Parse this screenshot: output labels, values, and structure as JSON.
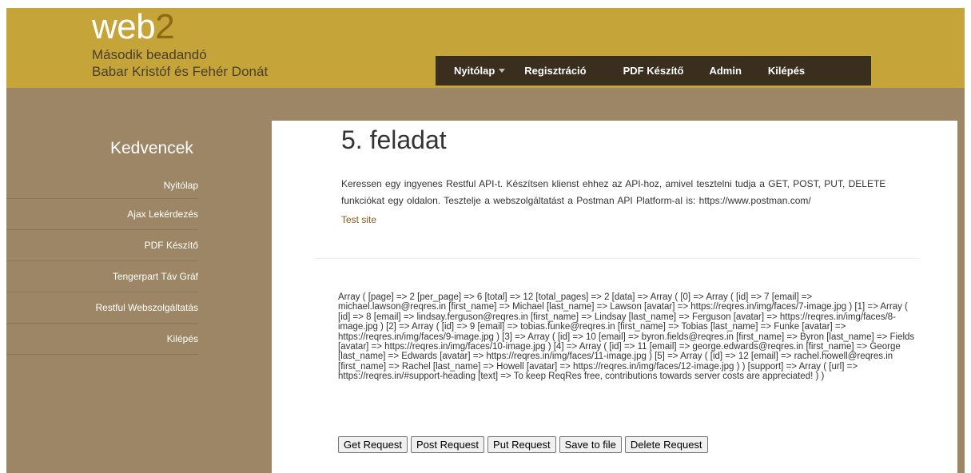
{
  "header": {
    "logo_main": "web",
    "logo_accent": "2",
    "subtitle_line1": "Második beadandó",
    "subtitle_line2": "Babar Kristóf és Fehér Donát"
  },
  "nav": {
    "items": [
      {
        "label": "Nyitólap"
      },
      {
        "label": "Regisztráció"
      },
      {
        "label": "PDF Készítő"
      },
      {
        "label": "Admin"
      },
      {
        "label": "Kilépés"
      }
    ]
  },
  "sidebar": {
    "title": "Kedvencek",
    "items": [
      {
        "label": "Nyitólap"
      },
      {
        "label": "Ajax Lekérdezés"
      },
      {
        "label": "PDF Készítő"
      },
      {
        "label": "Tengerpart Táv Gráf"
      },
      {
        "label": "Restful Webszolgáltatás"
      },
      {
        "label": "Kilépés"
      }
    ]
  },
  "main": {
    "title": "5. feladat",
    "description": "Keressen egy ingyenes Restful API-t. Készítsen klienst ehhez az API-hoz, amivel tesztelni tudja a GET, POST, PUT, DELETE funkciókat egy oldalon. Tesztelje a webszolgáltatást a Postman API Platform-al is: https://www.postman.com/",
    "test_link": "Test site",
    "output": "Array ( [page] => 2 [per_page] => 6 [total] => 12 [total_pages] => 2 [data] => Array ( [0] => Array ( [id] => 7 [email] => michael.lawson@reqres.in [first_name] => Michael [last_name] => Lawson [avatar] => https://reqres.in/img/faces/7-image.jpg ) [1] => Array ( [id] => 8 [email] => lindsay.ferguson@reqres.in [first_name] => Lindsay [last_name] => Ferguson [avatar] => https://reqres.in/img/faces/8-image.jpg ) [2] => Array ( [id] => 9 [email] => tobias.funke@reqres.in [first_name] => Tobias [last_name] => Funke [avatar] => https://reqres.in/img/faces/9-image.jpg ) [3] => Array ( [id] => 10 [email] => byron.fields@reqres.in [first_name] => Byron [last_name] => Fields [avatar] => https://reqres.in/img/faces/10-image.jpg ) [4] => Array ( [id] => 11 [email] => george.edwards@reqres.in [first_name] => George [last_name] => Edwards [avatar] => https://reqres.in/img/faces/11-image.jpg ) [5] => Array ( [id] => 12 [email] => rachel.howell@reqres.in [first_name] => Rachel [last_name] => Howell [avatar] => https://reqres.in/img/faces/12-image.jpg ) ) [support] => Array ( [url] => https://reqres.in/#support-heading [text] => To keep ReqRes free, contributions towards server costs are appreciated! ) )",
    "buttons": {
      "get": "Get Request",
      "post": "Post Request",
      "put": "Put Request",
      "save": "Save to file",
      "delete": "Delete Request"
    }
  },
  "colors": {
    "header_bg": "#c5a43a",
    "body_bg": "#9d8666",
    "nav_bg": "#3a2f1e",
    "link": "#8a5a12"
  }
}
